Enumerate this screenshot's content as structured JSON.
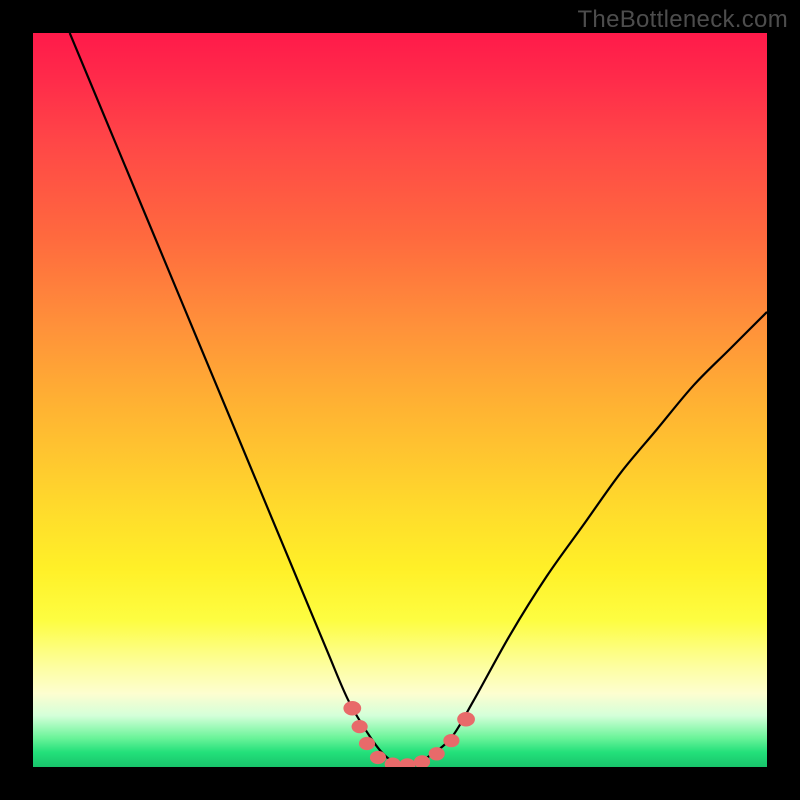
{
  "watermark": {
    "text": "TheBottleneck.com"
  },
  "colors": {
    "background": "#000000",
    "curve_stroke": "#000000",
    "marker_fill": "#e86a6a",
    "marker_stroke": "#c94f4f"
  },
  "chart_data": {
    "type": "line",
    "title": "",
    "xlabel": "",
    "ylabel": "",
    "xlim": [
      0,
      100
    ],
    "ylim": [
      0,
      100
    ],
    "grid": false,
    "legend": false,
    "series": [
      {
        "name": "bottleneck-curve",
        "x": [
          5,
          10,
          15,
          20,
          25,
          30,
          35,
          40,
          43,
          46,
          48,
          50,
          52,
          54,
          57,
          60,
          65,
          70,
          75,
          80,
          85,
          90,
          95,
          100
        ],
        "y": [
          100,
          88,
          76,
          64,
          52,
          40,
          28,
          16,
          9,
          4,
          1.5,
          0.3,
          0.3,
          1.5,
          4,
          9,
          18,
          26,
          33,
          40,
          46,
          52,
          57,
          62
        ]
      }
    ],
    "markers": [
      {
        "x": 43.5,
        "y": 8,
        "r": 1.1
      },
      {
        "x": 44.5,
        "y": 5.5,
        "r": 1.0
      },
      {
        "x": 45.5,
        "y": 3.2,
        "r": 1.0
      },
      {
        "x": 47.0,
        "y": 1.3,
        "r": 1.0
      },
      {
        "x": 49.0,
        "y": 0.4,
        "r": 1.0
      },
      {
        "x": 51.0,
        "y": 0.3,
        "r": 1.0
      },
      {
        "x": 53.0,
        "y": 0.7,
        "r": 1.0
      },
      {
        "x": 55.0,
        "y": 1.8,
        "r": 1.0
      },
      {
        "x": 57.0,
        "y": 3.6,
        "r": 1.0
      },
      {
        "x": 59.0,
        "y": 6.5,
        "r": 1.1
      }
    ]
  }
}
